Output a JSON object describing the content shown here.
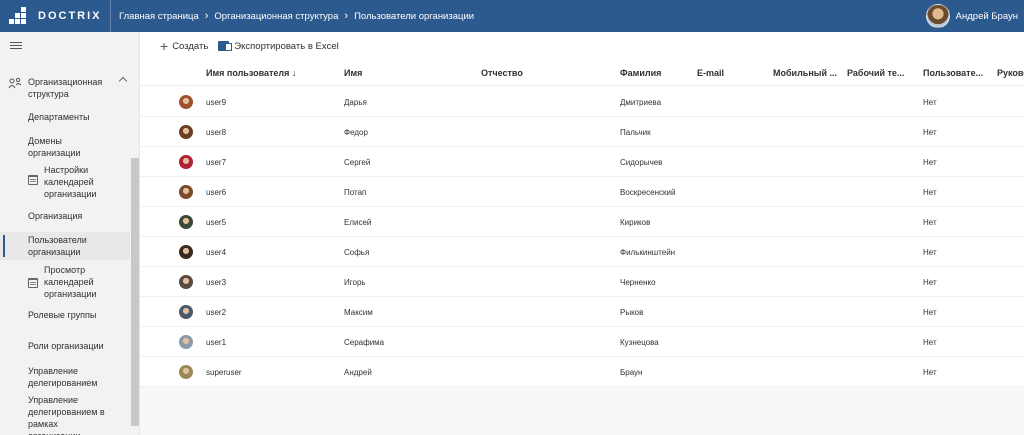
{
  "header": {
    "logo_text": "DOCTRIX",
    "breadcrumbs": [
      "Главная страница",
      "Организационная структура",
      "Пользователи организации"
    ],
    "user_name": "Андрей Браун",
    "bar_color": "#2d5a8e"
  },
  "sidebar": {
    "group_label": "Организационная структура",
    "items": [
      {
        "label": "Департаменты"
      },
      {
        "label": "Домены организации"
      },
      {
        "label": "Настройки календарей организации",
        "icon": "calendar-settings-icon"
      },
      {
        "label": "Организация"
      },
      {
        "label": "Пользователи организации",
        "active": true
      },
      {
        "label": "Просмотр календарей организации",
        "icon": "calendar-view-icon"
      },
      {
        "label": "Ролевые группы"
      },
      {
        "label": "Роли организации"
      },
      {
        "label": "Управление делегированием"
      },
      {
        "label": "Управление делегированием в рамках организации"
      }
    ]
  },
  "toolbar": {
    "create_label": "Создать",
    "export_label": "Экспортировать в Excel"
  },
  "table": {
    "columns": [
      "Имя пользователя ↓",
      "Имя",
      "Отчество",
      "Фамилия",
      "E-mail",
      "Мобильный ...",
      "Рабочий те...",
      "Пользовате...",
      "Руково"
    ],
    "rows": [
      {
        "username": "user9",
        "first": "Дарья",
        "middle": "",
        "last": "Дмитриева",
        "flag": "Нет",
        "avatar_color": "#a0522d"
      },
      {
        "username": "user8",
        "first": "Федор",
        "middle": "",
        "last": "Пальчик",
        "flag": "Нет",
        "avatar_color": "#6b3e26"
      },
      {
        "username": "user7",
        "first": "Сергей",
        "middle": "",
        "last": "Сидорычев",
        "flag": "Нет",
        "avatar_color": "#b22234"
      },
      {
        "username": "user6",
        "first": "Потап",
        "middle": "",
        "last": "Воскресенский",
        "flag": "Нет",
        "avatar_color": "#7a4a2a"
      },
      {
        "username": "user5",
        "first": "Елисей",
        "middle": "",
        "last": "Кириков",
        "flag": "Нет",
        "avatar_color": "#3a4a3a"
      },
      {
        "username": "user4",
        "first": "Софья",
        "middle": "",
        "last": "Филькинштейн",
        "flag": "Нет",
        "avatar_color": "#3b2a22"
      },
      {
        "username": "user3",
        "first": "Игорь",
        "middle": "",
        "last": "Черненко",
        "flag": "Нет",
        "avatar_color": "#5a4a44"
      },
      {
        "username": "user2",
        "first": "Максим",
        "middle": "",
        "last": "Рыков",
        "flag": "Нет",
        "avatar_color": "#4a5a6a"
      },
      {
        "username": "user1",
        "first": "Серафима",
        "middle": "",
        "last": "Кузнецова",
        "flag": "Нет",
        "avatar_color": "#8a9aaa"
      },
      {
        "username": "superuser",
        "first": "Андрей",
        "middle": "",
        "last": "Браун",
        "flag": "Нет",
        "avatar_color": "#9a8a5a"
      }
    ]
  }
}
